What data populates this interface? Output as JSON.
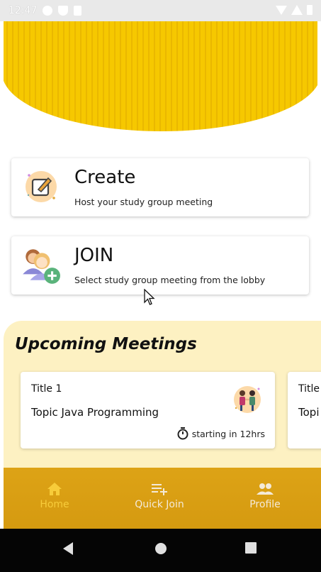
{
  "status_bar": {
    "time": "12:47"
  },
  "create_card": {
    "title": "Create",
    "subtitle": "Host your study group meeting"
  },
  "join_card": {
    "title": "JOIN",
    "subtitle": "Select study group meeting from the lobby"
  },
  "upcoming": {
    "heading": "Upcoming Meetings",
    "meetings": [
      {
        "title": "Title 1",
        "topic": "Topic Java Programming",
        "time": "starting in 12hrs"
      },
      {
        "title": "Title",
        "topic": "Topi"
      }
    ]
  },
  "bottom_nav": {
    "items": [
      {
        "label": "Home",
        "icon": "home-icon",
        "active": true
      },
      {
        "label": "Quick Join",
        "icon": "playlist-add-icon",
        "active": false
      },
      {
        "label": "Profile",
        "icon": "people-icon",
        "active": false
      }
    ]
  },
  "colors": {
    "accent": "#f6c800",
    "nav_bg": "#d99f12",
    "nav_active": "#f7cc3a",
    "upcoming_bg": "#fdf1c2"
  }
}
